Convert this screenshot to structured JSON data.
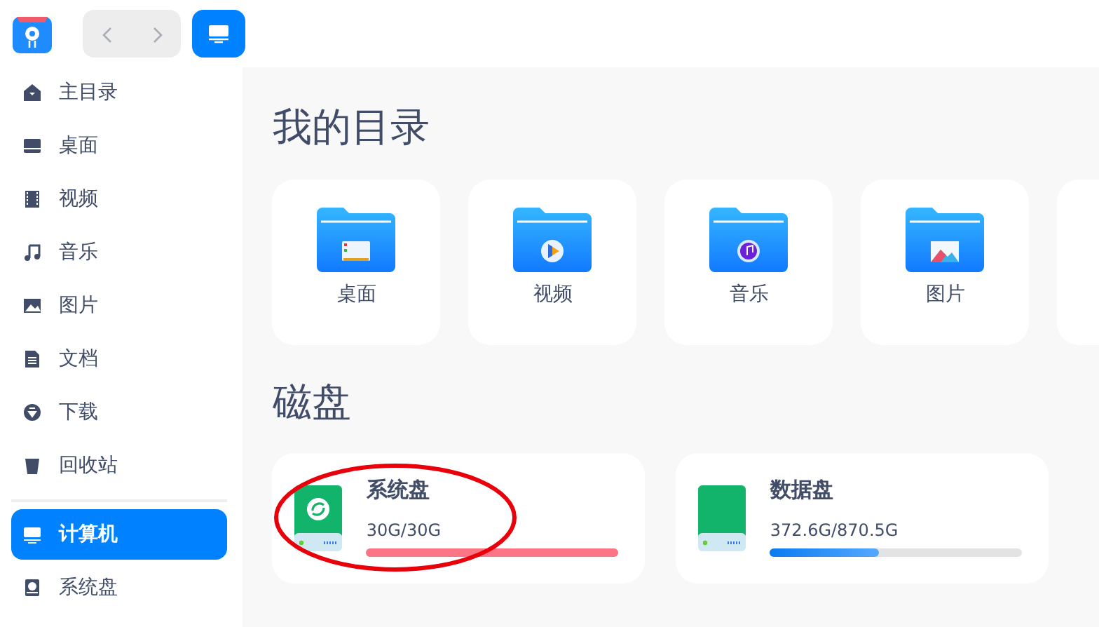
{
  "sidebar": {
    "items": [
      {
        "label": "主目录",
        "kind": "home",
        "selected": false
      },
      {
        "label": "桌面",
        "kind": "desktop",
        "selected": false
      },
      {
        "label": "视频",
        "kind": "video",
        "selected": false
      },
      {
        "label": "音乐",
        "kind": "music",
        "selected": false
      },
      {
        "label": "图片",
        "kind": "pictures",
        "selected": false
      },
      {
        "label": "文档",
        "kind": "document",
        "selected": false
      },
      {
        "label": "下载",
        "kind": "download",
        "selected": false
      },
      {
        "label": "回收站",
        "kind": "trash",
        "selected": false
      },
      {
        "label": "计算机",
        "kind": "computer",
        "selected": true
      },
      {
        "label": "系统盘",
        "kind": "disk",
        "selected": false
      }
    ]
  },
  "sections": [
    {
      "title": "我的目录",
      "folders": [
        {
          "label": "桌面",
          "kind": "desktop"
        },
        {
          "label": "视频",
          "kind": "video"
        },
        {
          "label": "音乐",
          "kind": "music"
        },
        {
          "label": "图片",
          "kind": "pictures"
        }
      ]
    },
    {
      "title": "磁盘",
      "disks": [
        {
          "name": "系统盘",
          "kind": "system",
          "usage": "30G/30G",
          "level": 1.0,
          "circled": true
        },
        {
          "name": "数据盘",
          "kind": "data",
          "usage": "372.6G/870.5G",
          "level": 0.43,
          "circled": false
        }
      ]
    }
  ]
}
